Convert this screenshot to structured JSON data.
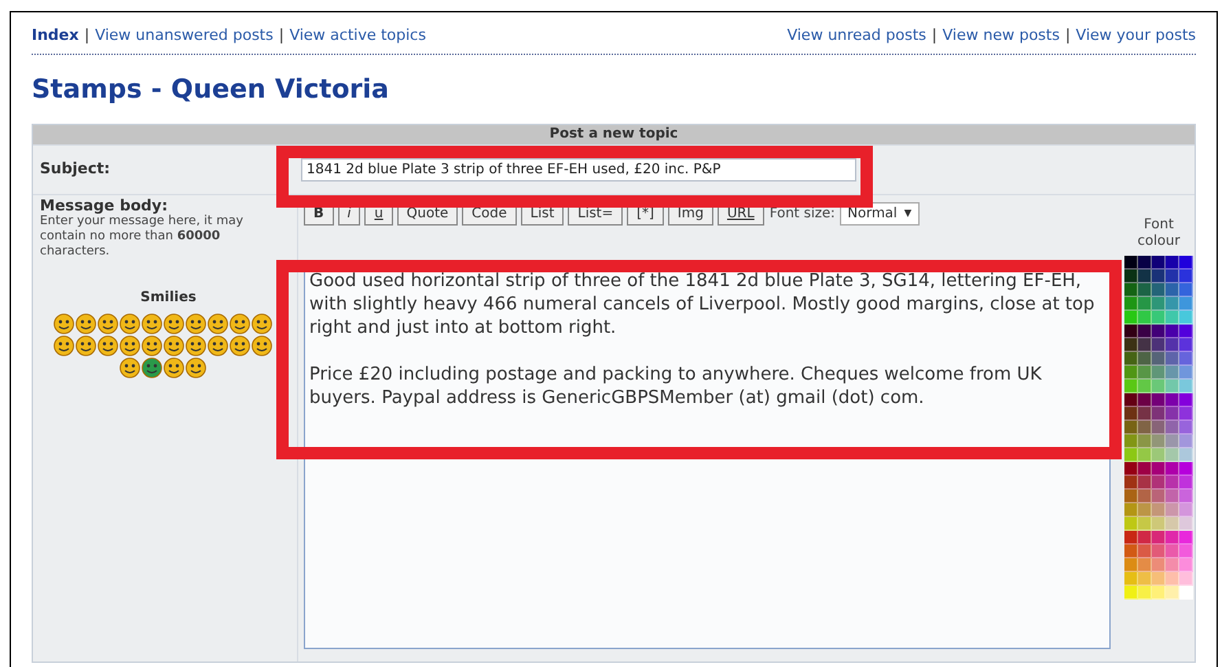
{
  "nav_left": [
    {
      "label": "Index",
      "selected": true
    },
    {
      "label": "View unanswered posts",
      "selected": false
    },
    {
      "label": "View active topics",
      "selected": false
    }
  ],
  "nav_right": [
    {
      "label": "View unread posts"
    },
    {
      "label": "View new posts"
    },
    {
      "label": "View your posts"
    }
  ],
  "nav_separator": "|",
  "title": "Stamps - Queen Victoria",
  "form": {
    "header": "Post a new topic",
    "subject_label": "Subject:",
    "subject_value": "1841 2d blue Plate 3 strip of three EF-EH used, £20 inc. P&P",
    "body_label": "Message body:",
    "body_hint": "Enter your message here, it may contain no more than **60000** characters.",
    "smilies_label": "Smilies",
    "toolbar": [
      {
        "label": "B",
        "kind": "bold"
      },
      {
        "label": "i",
        "kind": "italic"
      },
      {
        "label": "u",
        "kind": "underline"
      },
      {
        "label": "Quote",
        "kind": "plain"
      },
      {
        "label": "Code",
        "kind": "plain"
      },
      {
        "label": "List",
        "kind": "plain"
      },
      {
        "label": "List=",
        "kind": "plain"
      },
      {
        "label": "[*]",
        "kind": "plain"
      },
      {
        "label": "Img",
        "kind": "plain"
      },
      {
        "label": "URL",
        "kind": "underline"
      }
    ],
    "font_size_label": "Font size:",
    "font_size_value": "Normal",
    "dropdown_arrow": "▼",
    "body_value": "Good used horizontal strip of three of the 1841 2d blue Plate 3, SG14, lettering EF-EH, with slightly heavy 466 numeral cancels of Liverpool. Mostly good margins, close at top right and just into at bottom right.\n\nPrice £20 including postage and packing to anywhere. Cheques welcome from UK buyers. Paypal address is GenericGBPSMember (at) gmail (dot) com.",
    "font_colour_label": "Font colour"
  }
}
